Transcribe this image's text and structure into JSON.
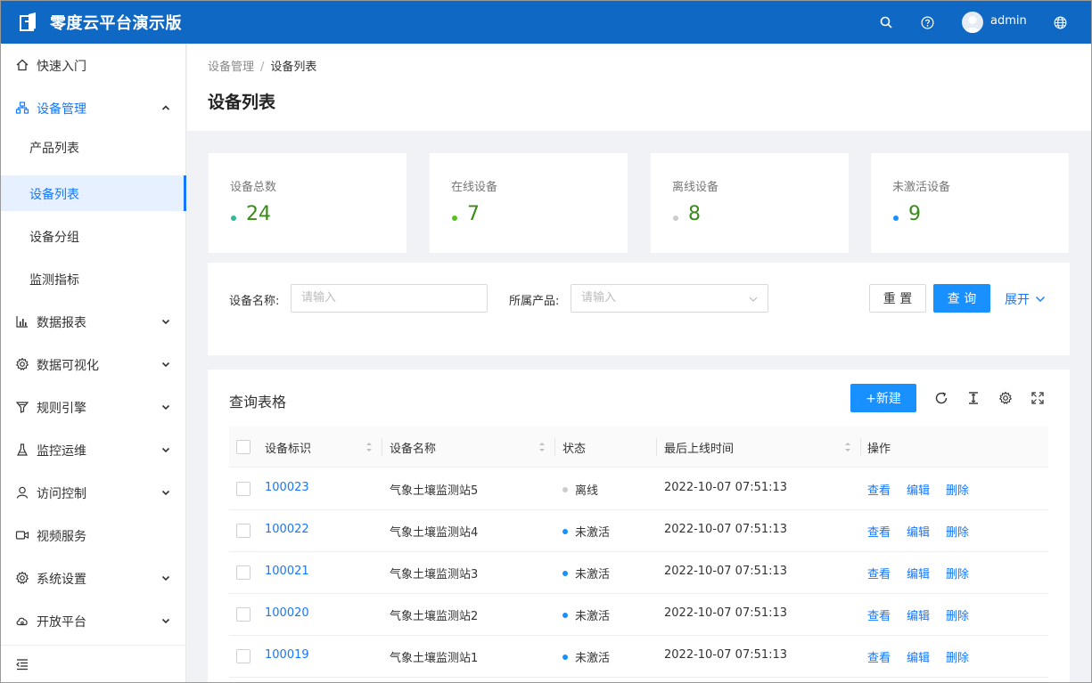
{
  "app": {
    "title": "零度云平台演示版",
    "user": "admin"
  },
  "icons": {
    "logo": "logo-icon",
    "search": "search-icon",
    "help": "help-icon",
    "avatar": "user-avatar-icon",
    "language": "globe-icon"
  },
  "colors": {
    "header": "#1068c5",
    "primary": "#1890ff",
    "online": "#2fb89a",
    "offline": "#cccccc",
    "inactive": "#1890ff"
  },
  "sidebar": {
    "items": [
      {
        "label": "快速入门"
      },
      {
        "label": "设备管理"
      },
      {
        "label": "数据报表"
      },
      {
        "label": "数据可视化"
      },
      {
        "label": "规则引擎"
      },
      {
        "label": "监控运维"
      },
      {
        "label": "访问控制"
      },
      {
        "label": "视频服务"
      },
      {
        "label": "系统设置"
      },
      {
        "label": "开放平台"
      }
    ],
    "sub_items": [
      {
        "label": "产品列表"
      },
      {
        "label": "设备列表"
      },
      {
        "label": "设备分组"
      },
      {
        "label": "监测指标"
      }
    ]
  },
  "breadcrumb": {
    "parent": "设备管理",
    "separator": "/",
    "current": "设备列表"
  },
  "page_title": "设备列表",
  "stats": [
    {
      "label": "设备总数",
      "value": "24"
    },
    {
      "label": "在线设备",
      "value": "7"
    },
    {
      "label": "离线设备",
      "value": "8"
    },
    {
      "label": "未激活设备",
      "value": "9"
    }
  ],
  "filter": {
    "name_label": "设备名称:",
    "name_placeholder": "请输入",
    "product_label": "所属产品:",
    "product_placeholder": "请输入",
    "reset_label": "重 置",
    "query_label": "查 询",
    "expand_label": "展开"
  },
  "table": {
    "title": "查询表格",
    "new_label": "+新建",
    "columns": [
      "设备标识",
      "设备名称",
      "状态",
      "最后上线时间",
      "操作"
    ],
    "actions": [
      "查看",
      "编辑",
      "删除"
    ],
    "rows": [
      {
        "id": "100023",
        "name": "气象土壤监测站5",
        "status": "离线",
        "time": "2022-10-07 07:51:13"
      },
      {
        "id": "100022",
        "name": "气象土壤监测站4",
        "status": "未激活",
        "time": "2022-10-07 07:51:13"
      },
      {
        "id": "100021",
        "name": "气象土壤监测站3",
        "status": "未激活",
        "time": "2022-10-07 07:51:13"
      },
      {
        "id": "100020",
        "name": "气象土壤监测站2",
        "status": "未激活",
        "time": "2022-10-07 07:51:13"
      },
      {
        "id": "100019",
        "name": "气象土壤监测站1",
        "status": "未激活",
        "time": "2022-10-07 07:51:13"
      }
    ]
  }
}
